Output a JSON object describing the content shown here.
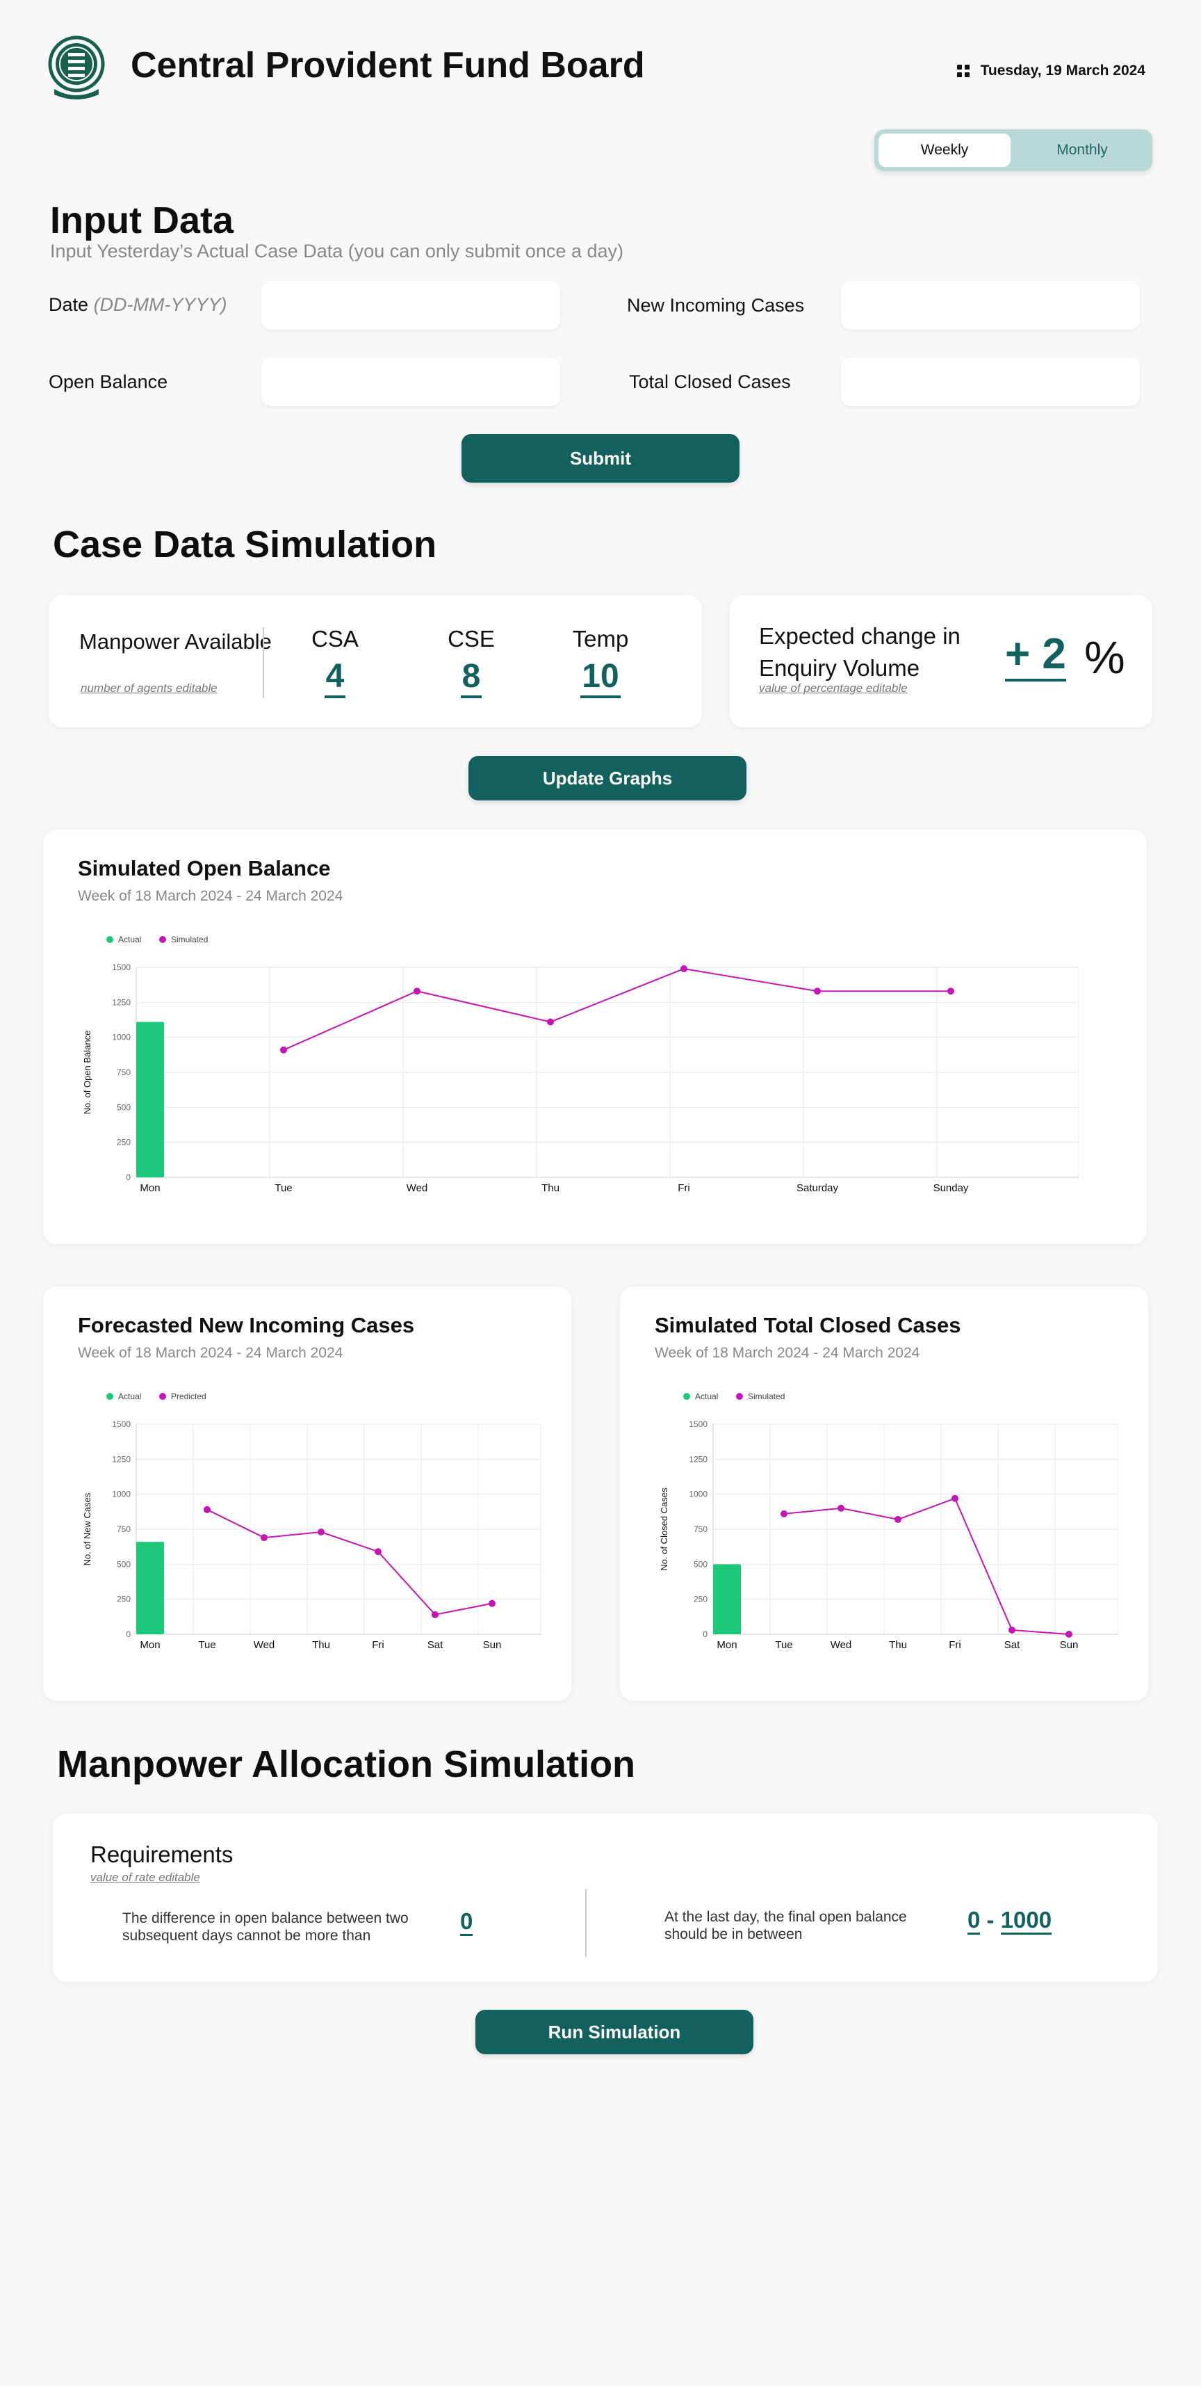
{
  "header": {
    "title": "Central Provident Fund Board",
    "date": "Tuesday, 19 March 2024",
    "logo_icon": "cpf-crest-icon"
  },
  "period_toggle": {
    "options": [
      "Weekly",
      "Monthly"
    ],
    "selected": "Weekly"
  },
  "input_data": {
    "heading": "Input Data",
    "subtitle": "Input Yesterday’s Actual Case Data (you can only submit once a day)",
    "fields": {
      "date_label": "Date",
      "date_hint": "(DD-MM-YYYY)",
      "date_value": "",
      "new_incoming_label": "New Incoming Cases",
      "new_incoming_value": "",
      "open_balance_label": "Open Balance",
      "open_balance_value": "",
      "total_closed_label": "Total Closed Cases",
      "total_closed_value": ""
    },
    "submit_label": "Submit"
  },
  "case_sim": {
    "heading": "Case Data Simulation",
    "manpower": {
      "label": "Manpower Available",
      "hint": "number of agents editable",
      "agents": [
        {
          "label": "CSA",
          "value": "4"
        },
        {
          "label": "CSE",
          "value": "8"
        },
        {
          "label": "Temp",
          "value": "10"
        }
      ]
    },
    "enquiry": {
      "label": "Expected change in Enquiry Volume",
      "hint": "value of percentage editable",
      "value": "+ 2",
      "unit": "%"
    },
    "update_label": "Update Graphs"
  },
  "manpower_alloc": {
    "heading": "Manpower Allocation Simulation",
    "requirements_title": "Requirements",
    "requirements_hint": "value of rate editable",
    "req1_text": "The difference in open balance between two subsequent days cannot be more than",
    "req1_value": "0",
    "req2_text": "At the last day, the final open balance should be in between",
    "req2_min": "0",
    "req2_sep": "-",
    "req2_max": "1000",
    "run_label": "Run Simulation"
  },
  "colors": {
    "primary": "#13615f",
    "actual": "#1ec87a",
    "series": "#c516b4",
    "toggle_bg": "#b9d8d6"
  },
  "chart_data": [
    {
      "type": "bar",
      "title": "Simulated Open Balance",
      "subtitle": "Week of 18 March 2024 - 24 March 2024",
      "ylabel": "No. of Open Balance",
      "xlabel": "",
      "categories": [
        "Mon",
        "Tue",
        "Wed",
        "Thu",
        "Fri",
        "Saturday",
        "Sunday"
      ],
      "yticks": [
        0,
        250,
        500,
        750,
        1000,
        1250,
        1500
      ],
      "ylim": [
        0,
        1500
      ],
      "series": [
        {
          "name": "Actual",
          "kind": "bar",
          "values": [
            1110,
            null,
            null,
            null,
            null,
            null,
            null
          ]
        },
        {
          "name": "Simulated",
          "kind": "line",
          "values": [
            null,
            910,
            1330,
            1110,
            1490,
            1330,
            1330
          ]
        }
      ],
      "legend": "top-left",
      "grid": true
    },
    {
      "type": "bar",
      "title": "Forecasted New Incoming Cases",
      "subtitle": "Week of 18 March 2024 - 24 March 2024",
      "ylabel": "No. of New Cases",
      "xlabel": "",
      "categories": [
        "Mon",
        "Tue",
        "Wed",
        "Thu",
        "Fri",
        "Sat",
        "Sun"
      ],
      "yticks": [
        0,
        250,
        500,
        750,
        1000,
        1250,
        1500
      ],
      "ylim": [
        0,
        1500
      ],
      "series": [
        {
          "name": "Actual",
          "kind": "bar",
          "values": [
            660,
            null,
            null,
            null,
            null,
            null,
            null
          ]
        },
        {
          "name": "Predicted",
          "kind": "line",
          "values": [
            null,
            890,
            690,
            730,
            590,
            140,
            220
          ]
        }
      ],
      "legend": "top-left",
      "grid": true
    },
    {
      "type": "bar",
      "title": "Simulated Total Closed Cases",
      "subtitle": "Week of 18 March 2024 - 24 March 2024",
      "ylabel": "No. of Closed Cases",
      "xlabel": "",
      "categories": [
        "Mon",
        "Tue",
        "Wed",
        "Thu",
        "Fri",
        "Sat",
        "Sun"
      ],
      "yticks": [
        0,
        250,
        500,
        750,
        1000,
        1250,
        1500
      ],
      "ylim": [
        0,
        1500
      ],
      "series": [
        {
          "name": "Actual",
          "kind": "bar",
          "values": [
            500,
            null,
            null,
            null,
            null,
            null,
            null
          ]
        },
        {
          "name": "Simulated",
          "kind": "line",
          "values": [
            null,
            860,
            900,
            820,
            970,
            30,
            0
          ]
        }
      ],
      "legend": "top-left",
      "grid": true
    }
  ]
}
